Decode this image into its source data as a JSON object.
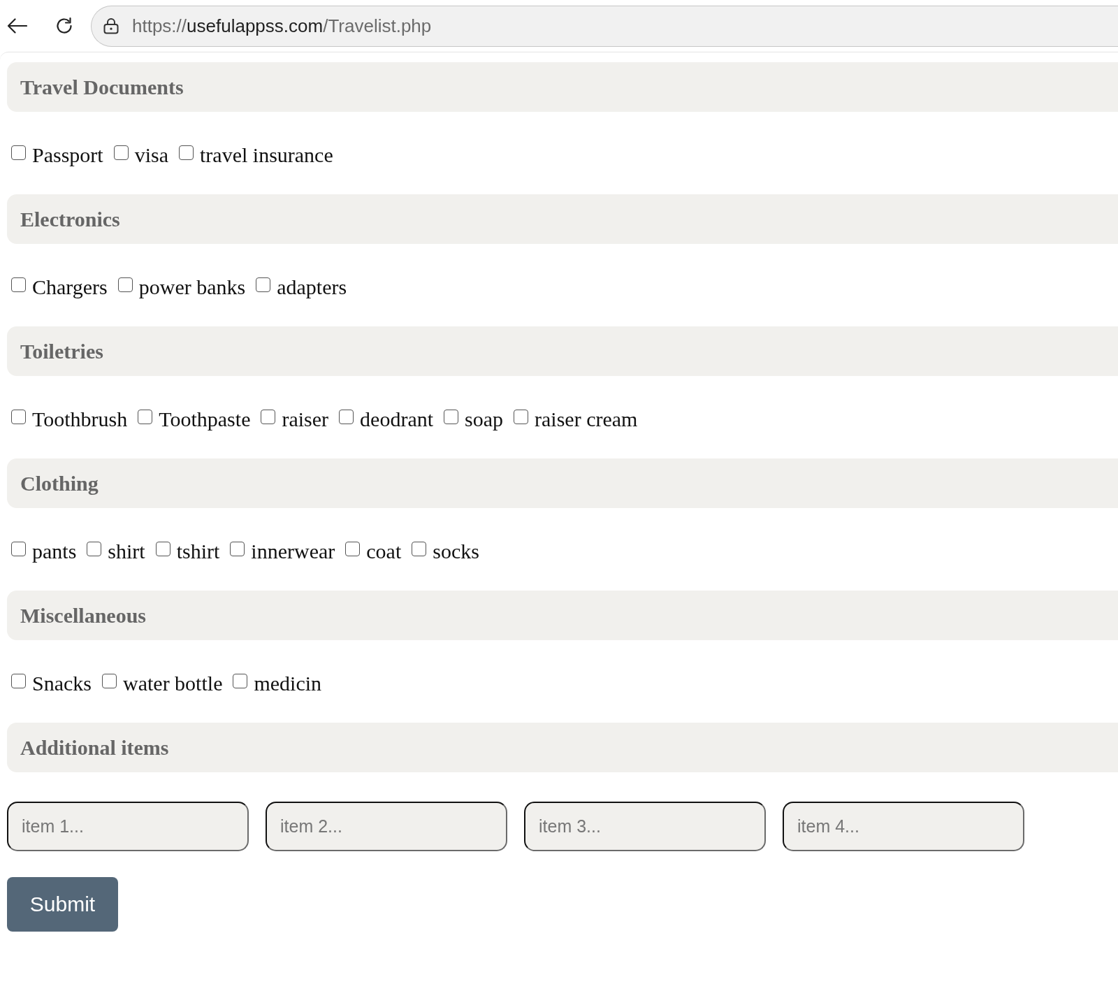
{
  "browser": {
    "url": {
      "scheme": "https://",
      "host": "usefulappss.com",
      "path": "/Travelist.php"
    }
  },
  "sections": [
    {
      "title": "Travel Documents",
      "kind": "checklist",
      "items": [
        {
          "label": "Passport",
          "checked": false
        },
        {
          "label": "visa",
          "checked": false
        },
        {
          "label": "travel insurance",
          "checked": false
        }
      ]
    },
    {
      "title": "Electronics",
      "kind": "checklist",
      "items": [
        {
          "label": "Chargers",
          "checked": false
        },
        {
          "label": "power banks",
          "checked": false
        },
        {
          "label": "adapters",
          "checked": false
        }
      ]
    },
    {
      "title": "Toiletries",
      "kind": "checklist",
      "items": [
        {
          "label": "Toothbrush",
          "checked": false
        },
        {
          "label": "Toothpaste",
          "checked": false
        },
        {
          "label": "raiser",
          "checked": false
        },
        {
          "label": "deodrant",
          "checked": false
        },
        {
          "label": "soap",
          "checked": false
        },
        {
          "label": "raiser cream",
          "checked": false
        }
      ]
    },
    {
      "title": "Clothing",
      "kind": "checklist",
      "items": [
        {
          "label": "pants",
          "checked": false
        },
        {
          "label": "shirt",
          "checked": false
        },
        {
          "label": "tshirt",
          "checked": false
        },
        {
          "label": "innerwear",
          "checked": false
        },
        {
          "label": "coat",
          "checked": false
        },
        {
          "label": "socks",
          "checked": false
        }
      ]
    },
    {
      "title": "Miscellaneous",
      "kind": "checklist",
      "items": [
        {
          "label": "Snacks",
          "checked": false
        },
        {
          "label": "water bottle",
          "checked": false
        },
        {
          "label": "medicin",
          "checked": false
        }
      ]
    },
    {
      "title": "Additional items",
      "kind": "inputs",
      "fields": [
        {
          "placeholder": "item 1..."
        },
        {
          "placeholder": "item 2..."
        },
        {
          "placeholder": "item 3..."
        },
        {
          "placeholder": "item 4..."
        }
      ]
    }
  ],
  "submit": {
    "label": "Submit"
  }
}
